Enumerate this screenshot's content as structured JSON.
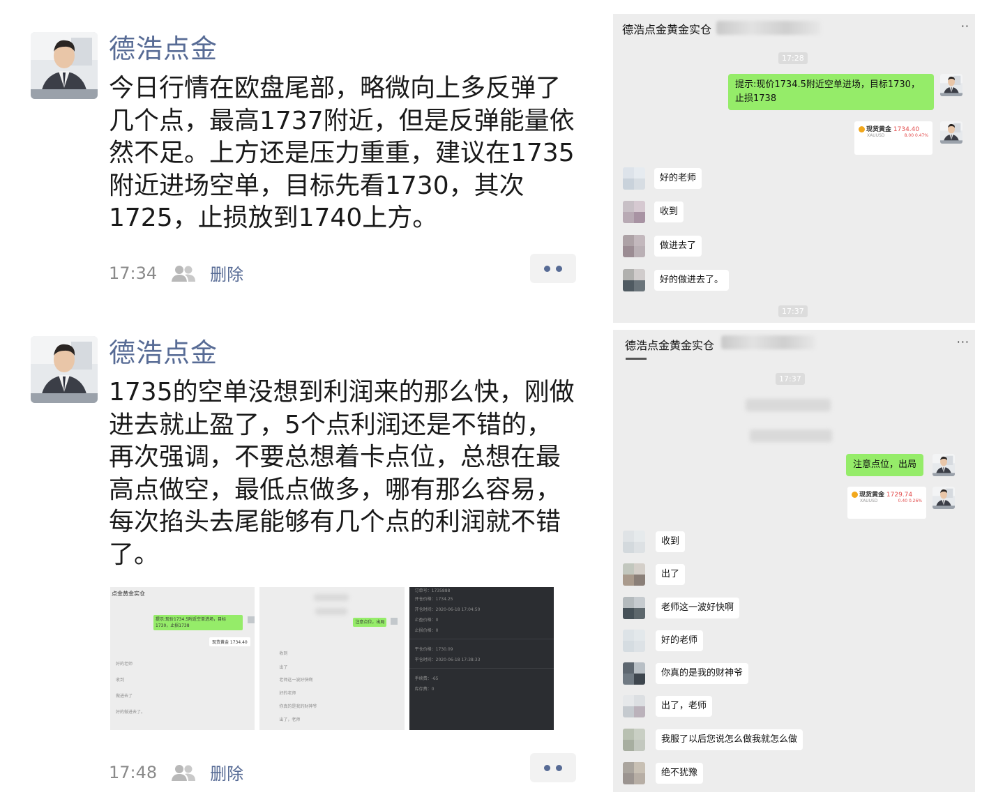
{
  "posts": [
    {
      "author": "德浩点金",
      "text": "今日行情在欧盘尾部，略微向上多反弹了几个点，最高1737附近，但是反弹能量依然不足。上方还是压力重重，建议在1735附近进场空单，目标先看1730，其次1725，止损放到1740上方。",
      "time": "17:34",
      "delete_label": "删除"
    },
    {
      "author": "德浩点金",
      "text": "1735的空单没想到利润来的那么快，刚做进去就止盈了，5个点利润还是不错的，再次强调，不要总想着卡点位，总想在最高点做空，最低点做多，哪有那么容易，每次掐头去尾能够有几个点的利润就不错了。",
      "time": "17:48",
      "delete_label": "删除"
    }
  ],
  "thumbs": {
    "t1": {
      "title": "点金黄金实仓",
      "tip": "提示:现价1734.5附近空单进场，目标1730，止损1738",
      "quote": "现货黄金 1734.40",
      "msgs": [
        "好的老师",
        "收到",
        "做进去了",
        "好的做进去了。"
      ]
    },
    "t2": {
      "btn": "注意点位，出局",
      "msgs": [
        "收到",
        "出了",
        "老师这一波好快啊",
        "好的老师",
        "你真的是我的财神爷",
        "出了，老师"
      ]
    },
    "t3": {
      "lines": [
        "订单号：1735888",
        "开仓价格：1734.25",
        "开仓时间：2020-06-18 17:04:50",
        "止盈价格：0",
        "止损价格：0",
        "平仓价格：1730.09",
        "平仓时间：2020-06-18 17:38:33",
        "手续费：-65",
        "库存费：0"
      ]
    }
  },
  "chat1": {
    "title": "德浩点金黄金实仓",
    "menu": "··",
    "time_top": "17:28",
    "tip_text": "提示:现价1734.5附近空单进场，目标1730，止损1738",
    "quote": {
      "name": "现货黄金",
      "price": "1734.40",
      "sub": "XAUUSD",
      "change": "8.00  0.47%"
    },
    "messages": [
      "好的老师",
      "收到",
      "做进去了",
      "好的做进去了。"
    ],
    "time_bottom": "17:37"
  },
  "chat2": {
    "title": "德浩点金黄金实仓",
    "menu": "···",
    "time_top": "17:37",
    "green_text": "注意点位，出局",
    "quote": {
      "name": "现货黄金",
      "price": "1729.74",
      "sub": "XAUUSD",
      "change": "0.40  0.26%"
    },
    "messages": [
      "收到",
      "出了",
      "老师这一波好快啊",
      "好的老师",
      "你真的是我的财神爷",
      "出了，老师",
      "我服了以后您说怎么做我就怎么做",
      "绝不犹豫"
    ]
  }
}
